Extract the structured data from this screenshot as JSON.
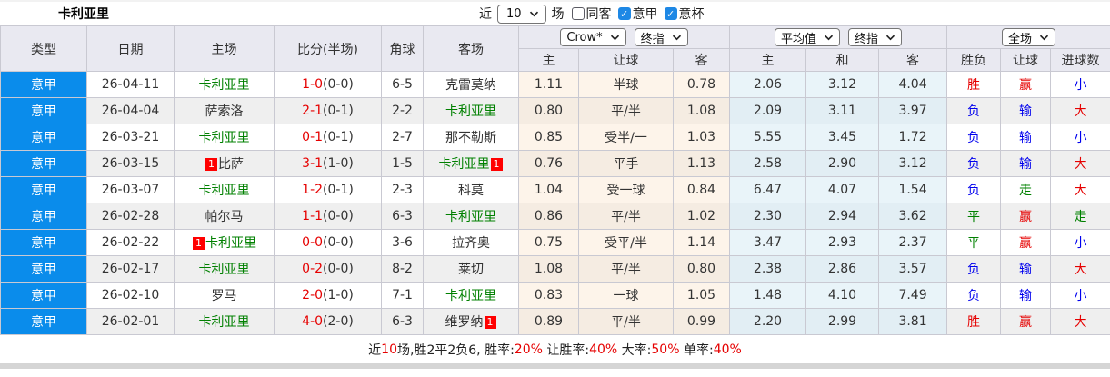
{
  "title": "卡利亚里",
  "filters": {
    "near_label": "近",
    "count_value": "10",
    "unit_label": "场",
    "checkboxes": [
      {
        "label": "同客",
        "checked": false
      },
      {
        "label": "意甲",
        "checked": true
      },
      {
        "label": "意杯",
        "checked": true
      }
    ]
  },
  "table": {
    "base_columns": [
      "类型",
      "日期",
      "主场",
      "比分(半场)",
      "角球",
      "客场"
    ],
    "asia_group": {
      "book_select": "Crow*",
      "time_select": "终指"
    },
    "avg_group": {
      "name_select": "平均值",
      "time_select": "终指"
    },
    "full_group": {
      "scope_select": "全场"
    },
    "sub_headers": [
      "主",
      "让球",
      "客",
      "主",
      "和",
      "客",
      "胜负",
      "让球",
      "进球数"
    ]
  },
  "rows": [
    {
      "league": "意甲",
      "date": "26-04-11",
      "home": {
        "name": "卡利亚里",
        "green": true
      },
      "score_ft": "1-0",
      "score_ht": "(0-0)",
      "corner": "6-5",
      "away": {
        "name": "克雷莫纳",
        "green": false
      },
      "odds": [
        "1.11",
        "半球",
        "0.78"
      ],
      "avg": [
        "2.06",
        "3.12",
        "4.04"
      ],
      "outcome": {
        "text": "胜",
        "color": "red"
      },
      "handicap": {
        "text": "赢",
        "color": "red"
      },
      "goals": {
        "text": "小",
        "color": "blue"
      }
    },
    {
      "league": "意甲",
      "date": "26-04-04",
      "home": {
        "name": "萨索洛",
        "green": false
      },
      "score_ft": "2-1",
      "score_ht": "(0-1)",
      "corner": "2-2",
      "away": {
        "name": "卡利亚里",
        "green": true
      },
      "odds": [
        "0.80",
        "平/半",
        "1.08"
      ],
      "avg": [
        "2.09",
        "3.11",
        "3.97"
      ],
      "outcome": {
        "text": "负",
        "color": "blue"
      },
      "handicap": {
        "text": "输",
        "color": "blue"
      },
      "goals": {
        "text": "大",
        "color": "red"
      }
    },
    {
      "league": "意甲",
      "date": "26-03-21",
      "home": {
        "name": "卡利亚里",
        "green": true
      },
      "score_ft": "0-1",
      "score_ht": "(0-1)",
      "corner": "2-7",
      "away": {
        "name": "那不勒斯",
        "green": false
      },
      "odds": [
        "0.85",
        "受半/一",
        "1.03"
      ],
      "avg": [
        "5.55",
        "3.45",
        "1.72"
      ],
      "outcome": {
        "text": "负",
        "color": "blue"
      },
      "handicap": {
        "text": "输",
        "color": "blue"
      },
      "goals": {
        "text": "小",
        "color": "blue"
      }
    },
    {
      "league": "意甲",
      "date": "26-03-15",
      "home": {
        "name": "比萨",
        "green": false,
        "badge_before": "1"
      },
      "score_ft": "3-1",
      "score_ht": "(1-0)",
      "corner": "1-5",
      "away": {
        "name": "卡利亚里",
        "green": true,
        "badge_after": "1"
      },
      "odds": [
        "0.76",
        "平手",
        "1.13"
      ],
      "avg": [
        "2.58",
        "2.90",
        "3.12"
      ],
      "outcome": {
        "text": "负",
        "color": "blue"
      },
      "handicap": {
        "text": "输",
        "color": "blue"
      },
      "goals": {
        "text": "大",
        "color": "red"
      }
    },
    {
      "league": "意甲",
      "date": "26-03-07",
      "home": {
        "name": "卡利亚里",
        "green": true
      },
      "score_ft": "1-2",
      "score_ht": "(0-1)",
      "corner": "2-3",
      "away": {
        "name": "科莫",
        "green": false
      },
      "odds": [
        "1.04",
        "受一球",
        "0.84"
      ],
      "avg": [
        "6.47",
        "4.07",
        "1.54"
      ],
      "outcome": {
        "text": "负",
        "color": "blue"
      },
      "handicap": {
        "text": "走",
        "color": "green"
      },
      "goals": {
        "text": "大",
        "color": "red"
      }
    },
    {
      "league": "意甲",
      "date": "26-02-28",
      "home": {
        "name": "帕尔马",
        "green": false
      },
      "score_ft": "1-1",
      "score_ht": "(0-0)",
      "corner": "6-3",
      "away": {
        "name": "卡利亚里",
        "green": true
      },
      "odds": [
        "0.86",
        "平/半",
        "1.02"
      ],
      "avg": [
        "2.30",
        "2.94",
        "3.62"
      ],
      "outcome": {
        "text": "平",
        "color": "green"
      },
      "handicap": {
        "text": "赢",
        "color": "red"
      },
      "goals": {
        "text": "走",
        "color": "green"
      }
    },
    {
      "league": "意甲",
      "date": "26-02-22",
      "home": {
        "name": "卡利亚里",
        "green": true,
        "badge_before": "1"
      },
      "score_ft": "0-0",
      "score_ht": "(0-0)",
      "corner": "3-6",
      "away": {
        "name": "拉齐奥",
        "green": false
      },
      "odds": [
        "0.75",
        "受平/半",
        "1.14"
      ],
      "avg": [
        "3.47",
        "2.93",
        "2.37"
      ],
      "outcome": {
        "text": "平",
        "color": "green"
      },
      "handicap": {
        "text": "赢",
        "color": "red"
      },
      "goals": {
        "text": "小",
        "color": "blue"
      }
    },
    {
      "league": "意甲",
      "date": "26-02-17",
      "home": {
        "name": "卡利亚里",
        "green": true
      },
      "score_ft": "0-2",
      "score_ht": "(0-0)",
      "corner": "8-2",
      "away": {
        "name": "莱切",
        "green": false
      },
      "odds": [
        "1.08",
        "平/半",
        "0.80"
      ],
      "avg": [
        "2.38",
        "2.86",
        "3.57"
      ],
      "outcome": {
        "text": "负",
        "color": "blue"
      },
      "handicap": {
        "text": "输",
        "color": "blue"
      },
      "goals": {
        "text": "大",
        "color": "red"
      }
    },
    {
      "league": "意甲",
      "date": "26-02-10",
      "home": {
        "name": "罗马",
        "green": false
      },
      "score_ft": "2-0",
      "score_ht": "(1-0)",
      "corner": "7-1",
      "away": {
        "name": "卡利亚里",
        "green": true
      },
      "odds": [
        "0.83",
        "一球",
        "1.05"
      ],
      "avg": [
        "1.48",
        "4.10",
        "7.49"
      ],
      "outcome": {
        "text": "负",
        "color": "blue"
      },
      "handicap": {
        "text": "输",
        "color": "blue"
      },
      "goals": {
        "text": "小",
        "color": "blue"
      }
    },
    {
      "league": "意甲",
      "date": "26-02-01",
      "home": {
        "name": "卡利亚里",
        "green": true
      },
      "score_ft": "4-0",
      "score_ht": "(2-0)",
      "corner": "6-3",
      "away": {
        "name": "维罗纳",
        "green": false,
        "badge_after": "1"
      },
      "odds": [
        "0.89",
        "平/半",
        "0.99"
      ],
      "avg": [
        "2.20",
        "2.99",
        "3.81"
      ],
      "outcome": {
        "text": "胜",
        "color": "red"
      },
      "handicap": {
        "text": "赢",
        "color": "red"
      },
      "goals": {
        "text": "大",
        "color": "red"
      }
    }
  ],
  "footer": {
    "seg_near": "近",
    "count": "10",
    "seg_record": "场,胜2平2负6, 胜率:",
    "win_rate": "20%",
    "seg_handicap_rate": " 让胜率:",
    "handicap_rate": "40%",
    "seg_big_rate": " 大率:",
    "big_rate": "50%",
    "seg_single_rate": " 单率:",
    "single_rate": "40%"
  },
  "colors": {
    "red": "#e60000",
    "blue": "#0000ee",
    "green": "#008000",
    "accent_blue": "#0a8ceb",
    "badge_red": "#ff0000",
    "checkbox_blue": "#1e88e5"
  }
}
